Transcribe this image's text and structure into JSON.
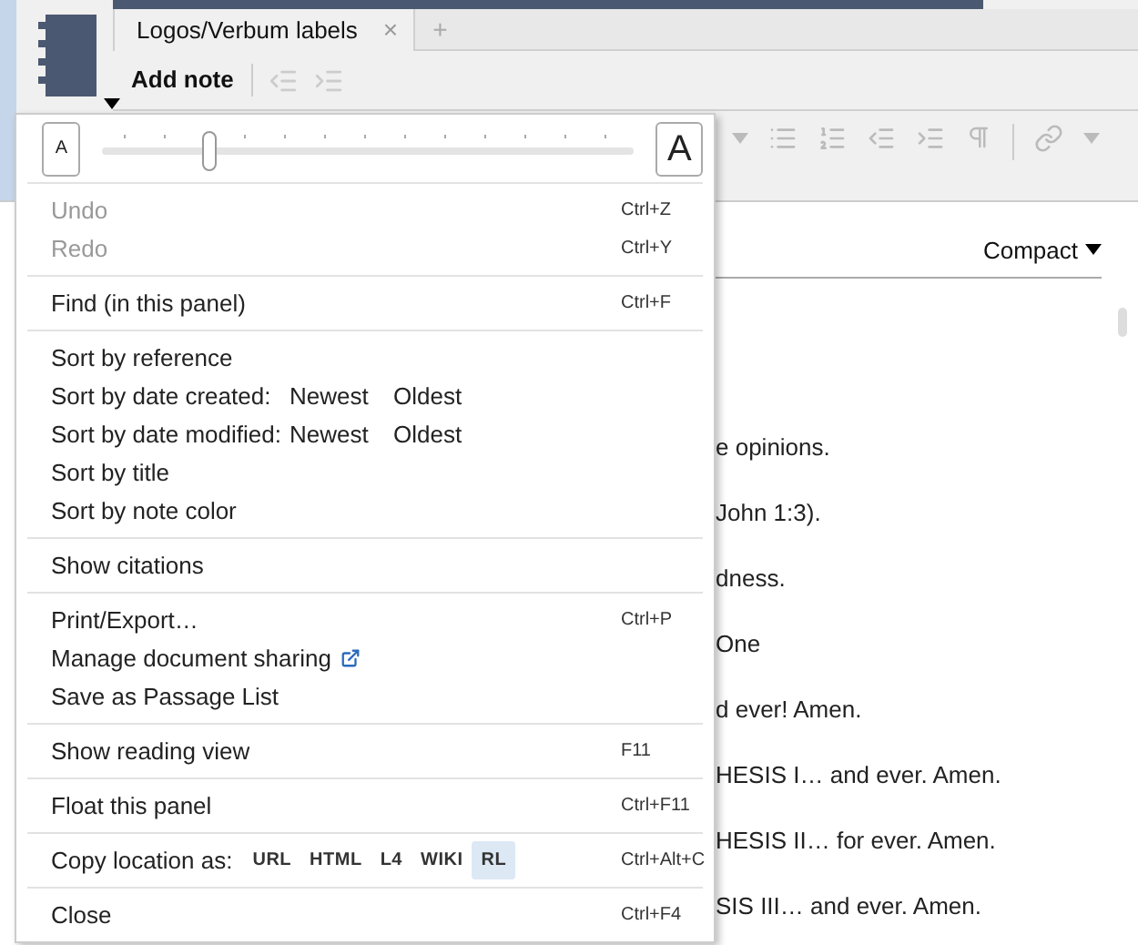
{
  "tab": {
    "title": "Logos/Verbum labels",
    "close": "×",
    "new_tab": "+"
  },
  "toolbar": {
    "add_note": "Add note"
  },
  "view": {
    "label": "Compact"
  },
  "content_lines": [
    "e opinions.",
    "John 1:3).",
    "dness.",
    "One",
    "d ever! Amen.",
    "HESIS I… and ever. Amen.",
    "HESIS II… for ever. Amen.",
    "SIS III… and ever. Amen."
  ],
  "font_size": {
    "small": "A",
    "large": "A",
    "level": 0.2
  },
  "menu": [
    [
      {
        "kind": "item",
        "label": "Undo",
        "shortcut": "Ctrl+Z",
        "disabled": true
      },
      {
        "kind": "item",
        "label": "Redo",
        "shortcut": "Ctrl+Y",
        "disabled": true
      }
    ],
    [
      {
        "kind": "item",
        "label": "Find (in this panel)",
        "shortcut": "Ctrl+F",
        "disabled": false
      }
    ],
    [
      {
        "kind": "item",
        "label": "Sort by reference",
        "disabled": false
      },
      {
        "kind": "sort",
        "label": "Sort by date created:",
        "options": [
          "Newest",
          "Oldest"
        ]
      },
      {
        "kind": "sort",
        "label": "Sort by date modified:",
        "options": [
          "Newest",
          "Oldest"
        ]
      },
      {
        "kind": "item",
        "label": "Sort by title",
        "disabled": false
      },
      {
        "kind": "item",
        "label": "Sort by note color",
        "disabled": false
      }
    ],
    [
      {
        "kind": "item",
        "label": "Show citations",
        "disabled": false
      }
    ],
    [
      {
        "kind": "item",
        "label": "Print/Export…",
        "shortcut": "Ctrl+P",
        "disabled": false
      },
      {
        "kind": "link",
        "label": "Manage document sharing"
      },
      {
        "kind": "item",
        "label": "Save as Passage List",
        "disabled": false
      }
    ],
    [
      {
        "kind": "item",
        "label": "Show reading view",
        "shortcut": "F11",
        "disabled": false
      }
    ],
    [
      {
        "kind": "item",
        "label": "Float this panel",
        "shortcut": "Ctrl+F11",
        "disabled": false
      }
    ],
    [
      {
        "kind": "copy",
        "label": "Copy location as:",
        "shortcut": "Ctrl+Alt+C",
        "formats": [
          {
            "label": "URL",
            "selected": false
          },
          {
            "label": "HTML",
            "selected": false
          },
          {
            "label": "L4",
            "selected": false
          },
          {
            "label": "WIKI",
            "selected": false
          },
          {
            "label": "RL",
            "selected": true
          }
        ]
      }
    ],
    [
      {
        "kind": "item",
        "label": "Close",
        "shortcut": "Ctrl+F4",
        "disabled": false
      }
    ]
  ]
}
